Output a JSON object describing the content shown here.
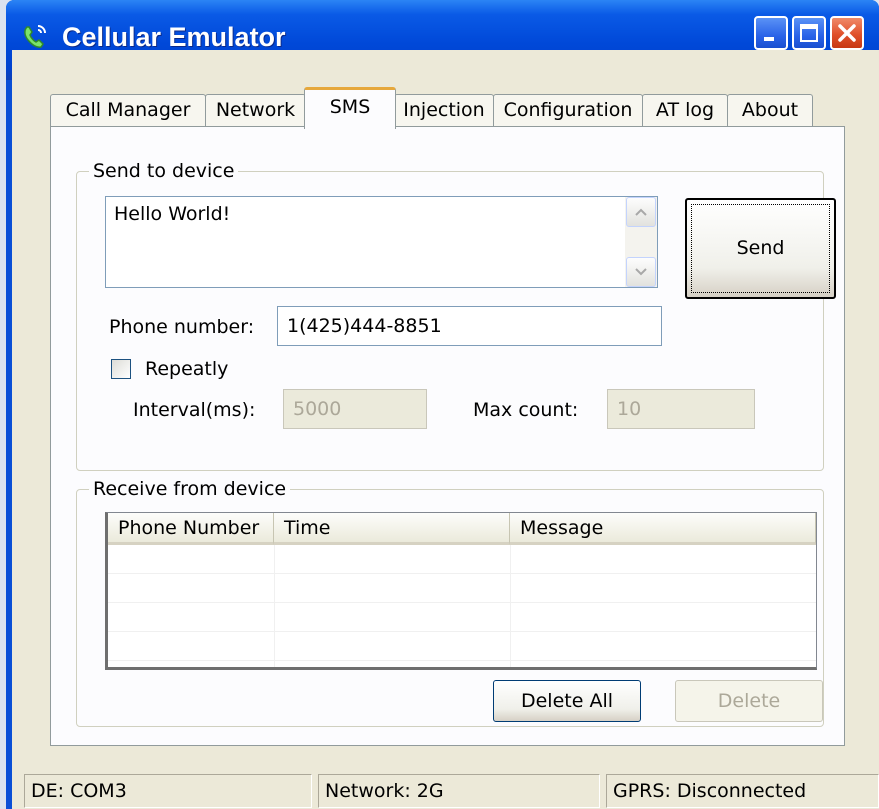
{
  "window": {
    "title": "Cellular Emulator"
  },
  "tabs": [
    "Call Manager",
    "Network",
    "SMS",
    "Injection",
    "Configuration",
    "AT log",
    "About"
  ],
  "send": {
    "group_label": "Send to device",
    "message": "Hello World!",
    "send_label": "Send",
    "phone_label": "Phone number:",
    "phone_value": "1(425)444-8851",
    "repeat_label": "Repeatly",
    "repeat_checked": false,
    "interval_label": "Interval(ms):",
    "interval_value": "5000",
    "maxcount_label": "Max count:",
    "maxcount_value": "10"
  },
  "receive": {
    "group_label": "Receive from device",
    "columns": [
      "Phone Number",
      "Time",
      "Message"
    ],
    "rows": [],
    "delete_all_label": "Delete All",
    "delete_label": "Delete"
  },
  "status": {
    "device": "DE: COM3",
    "network": "Network: 2G",
    "gprs": "GPRS: Disconnected"
  },
  "colors": {
    "titlebar": "#0048d8",
    "dialog_bg": "#ece9d8",
    "active_tab_accent": "#e6a83c"
  }
}
